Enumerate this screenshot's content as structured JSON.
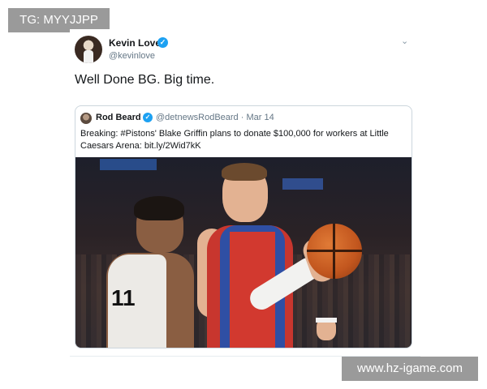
{
  "watermarks": {
    "top_left": "TG: MYYJJPP",
    "bottom_right": "www.hz-igame.com"
  },
  "tweet": {
    "author_name": "Kevin Love",
    "author_handle": "@kevinlove",
    "verified_icon": "verified-badge-icon",
    "text": "Well Done BG. Big time.",
    "quote": {
      "author_name": "Rod Beard",
      "handle_date": "@detnewsRodBeard · Mar 14",
      "text": "Breaking: #Pistons' Blake Griffin plans to donate $100,000 for workers at Little Caesars Arena: bit.ly/2Wid7kK",
      "photo": {
        "jersey_letters": "11"
      }
    }
  },
  "colors": {
    "verified_blue": "#1da1f2",
    "watermark_gray": "#9a9a9a",
    "secondary_text": "#657786"
  }
}
